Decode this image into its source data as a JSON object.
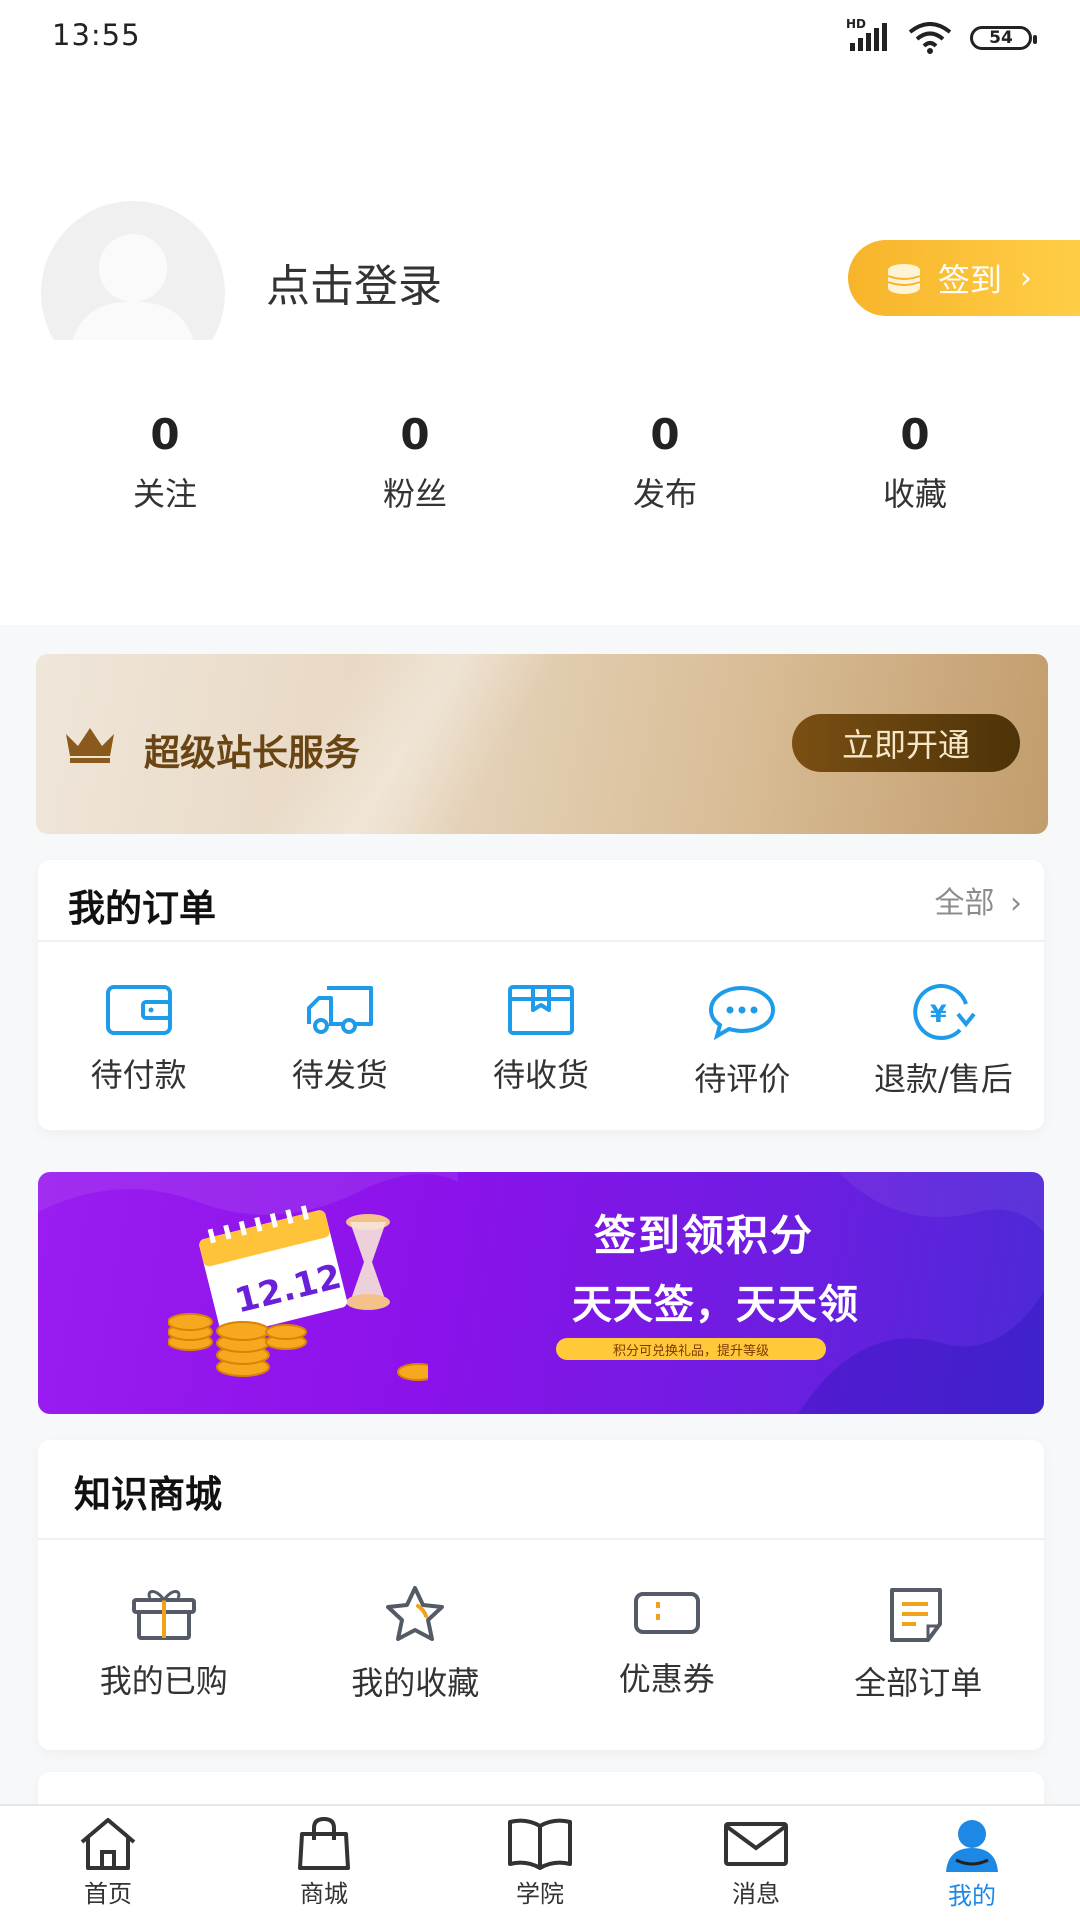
{
  "status_bar": {
    "time": "13:55",
    "signal_label": "HD",
    "battery": "54"
  },
  "profile": {
    "login_text": "点击登录",
    "signin_label": "签到"
  },
  "stats": [
    {
      "value": "0",
      "label": "关注"
    },
    {
      "value": "0",
      "label": "粉丝"
    },
    {
      "value": "0",
      "label": "发布"
    },
    {
      "value": "0",
      "label": "收藏"
    }
  ],
  "vip": {
    "title": "超级站长服务",
    "button": "立即开通"
  },
  "orders": {
    "title": "我的订单",
    "see_all": "全部",
    "items": [
      {
        "label": "待付款",
        "icon": "wallet-icon"
      },
      {
        "label": "待发货",
        "icon": "delivery-truck-icon"
      },
      {
        "label": "待收货",
        "icon": "package-icon"
      },
      {
        "label": "待评价",
        "icon": "chat-bubble-icon"
      },
      {
        "label": "退款/售后",
        "icon": "refund-icon"
      }
    ]
  },
  "promo": {
    "title": "签到领积分",
    "subtitle": "天天签，天天领",
    "pill": "积分可兑换礼品，提升等级",
    "calendar_date": "12.12"
  },
  "mall": {
    "title": "知识商城",
    "items": [
      {
        "label": "我的已购",
        "icon": "gift-box-icon"
      },
      {
        "label": "我的收藏",
        "icon": "star-icon"
      },
      {
        "label": "优惠券",
        "icon": "coupon-icon"
      },
      {
        "label": "全部订单",
        "icon": "order-list-icon"
      }
    ]
  },
  "tabbar": [
    {
      "label": "首页",
      "icon": "home-icon"
    },
    {
      "label": "商城",
      "icon": "shopping-bag-icon"
    },
    {
      "label": "学院",
      "icon": "open-book-icon"
    },
    {
      "label": "消息",
      "icon": "mail-icon"
    },
    {
      "label": "我的",
      "icon": "user-icon",
      "active": true
    }
  ],
  "colors": {
    "accent": "#1e88e5",
    "signin": "#f7b42b",
    "vip_button": "#5e3d0c",
    "promo": "#8b12ea"
  }
}
